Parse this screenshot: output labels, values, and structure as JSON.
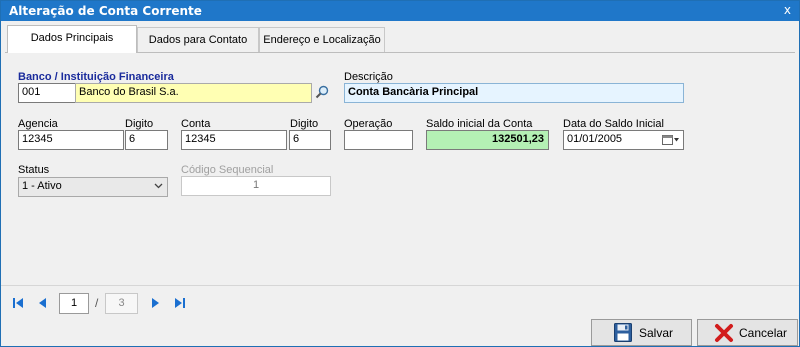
{
  "window": {
    "title": "Alteração de Conta Corrente",
    "close_label": "x"
  },
  "tabs": [
    {
      "label": "Dados Principais",
      "active": true
    },
    {
      "label": "Dados para Contato",
      "active": false
    },
    {
      "label": "Endereço e Localização",
      "active": false
    }
  ],
  "banco": {
    "label": "Banco / Instituição Financeira",
    "code": "001",
    "name": "Banco do Brasil S.a."
  },
  "descricao": {
    "label": "Descrição",
    "value": "Conta Bancària Principal"
  },
  "agencia": {
    "label": "Agencia",
    "value": "12345"
  },
  "agencia_digito": {
    "label": "Digito",
    "value": "6"
  },
  "conta": {
    "label": "Conta",
    "value": "12345"
  },
  "conta_digito": {
    "label": "Digito",
    "value": "6"
  },
  "operacao": {
    "label": "Operação",
    "value": ""
  },
  "saldo_inicial": {
    "label": "Saldo inicial da Conta",
    "value": "132501,23"
  },
  "data_saldo": {
    "label": "Data do Saldo Inicial",
    "value": "01/01/2005"
  },
  "status": {
    "label": "Status",
    "value": "1 - Ativo"
  },
  "codigo_sequencial": {
    "label": "Código Sequencial",
    "value": "1"
  },
  "pagination": {
    "current": "1",
    "separator": "/",
    "total": "3"
  },
  "buttons": {
    "save": "Salvar",
    "cancel": "Cancelar"
  },
  "colors": {
    "titlebar": "#1f77c9",
    "banco_bg": "#ffffb3",
    "descricao_bg": "#e6f4ff",
    "saldo_bg": "#b4f0b4",
    "label_blue": "#1a2b9c",
    "nav_blue": "#1a6fd0"
  },
  "icons": {
    "search": "search-icon",
    "calendar": "calendar-icon",
    "dropdown": "chevron-down-icon",
    "first": "first-page-icon",
    "prev": "prev-page-icon",
    "next": "next-page-icon",
    "last": "last-page-icon",
    "save": "floppy-disk-icon",
    "cancel": "red-x-icon"
  }
}
